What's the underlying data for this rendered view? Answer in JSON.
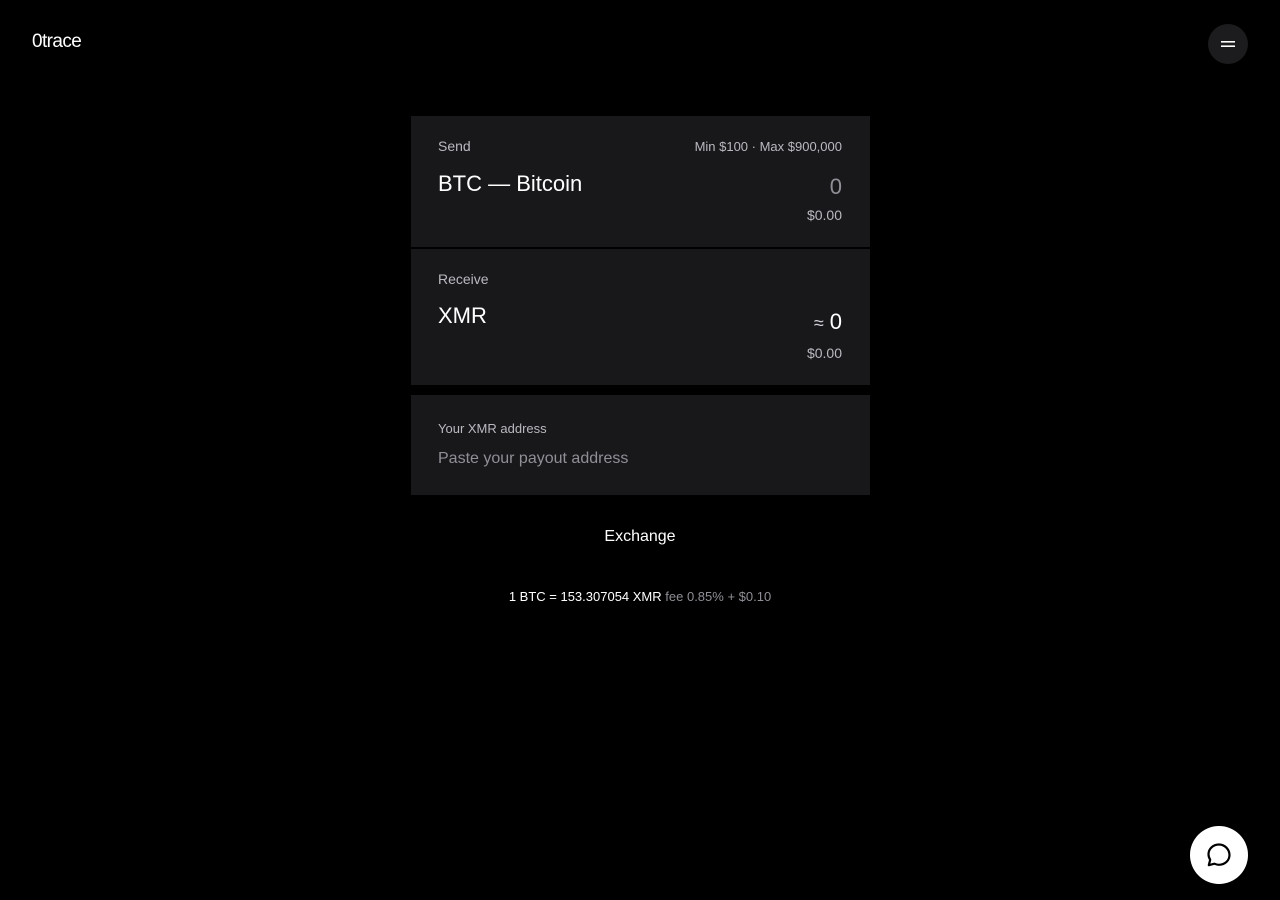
{
  "header": {
    "logo": "0trace",
    "menu_icon": "menu-icon"
  },
  "send": {
    "label": "Send",
    "limits": "Min $100 · Max $900,000",
    "asset": "BTC — Bitcoin",
    "amount": "0",
    "usd_value": "$0.00"
  },
  "receive": {
    "label": "Receive",
    "asset": "XMR",
    "approx_symbol": "≈",
    "amount": "0",
    "usd_value": "$0.00"
  },
  "address": {
    "label": "Your XMR address",
    "placeholder": "Paste your payout address",
    "value": ""
  },
  "exchange_button": "Exchange",
  "rate": {
    "main": "1 BTC = 153.307054 XMR",
    "fee": "fee 0.85% + $0.10"
  },
  "chat": {
    "icon": "chat-bubble-icon"
  },
  "colors": {
    "background": "#000000",
    "card": "#18181b",
    "muted_text": "#b9b9bf",
    "placeholder_text": "#8f8f96",
    "menu_button": "#1c1c1f",
    "chat_button": "#ffffff"
  }
}
